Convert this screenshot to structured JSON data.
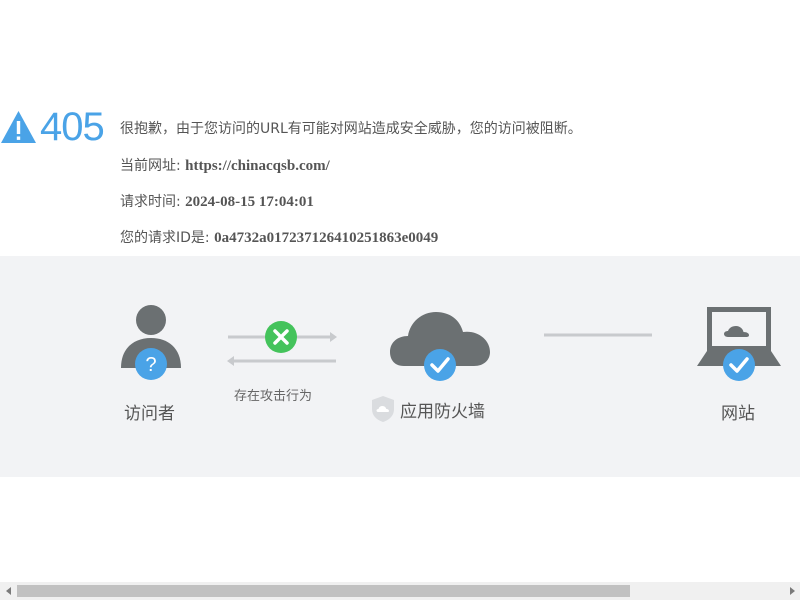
{
  "error": {
    "code": "405",
    "message": "很抱歉，由于您访问的URL有可能对网站造成安全威胁，您的访问被阻断。",
    "url_label": "当前网址: ",
    "url_value": "https://chinacqsb.com/",
    "time_label": "请求时间: ",
    "time_value": "2024-08-15 17:04:01",
    "id_label": "您的请求ID是: ",
    "id_value": "0a4732a017237126410251863e0049"
  },
  "diagram": {
    "visitor_label": "访问者",
    "attack_label": "存在攻击行为",
    "firewall_label": "应用防火墙",
    "website_label": "网站"
  },
  "colors": {
    "accent_blue": "#4aa3e7",
    "block_green": "#44c35b",
    "icon_gray": "#6b7072",
    "band_bg": "#f2f3f5"
  }
}
